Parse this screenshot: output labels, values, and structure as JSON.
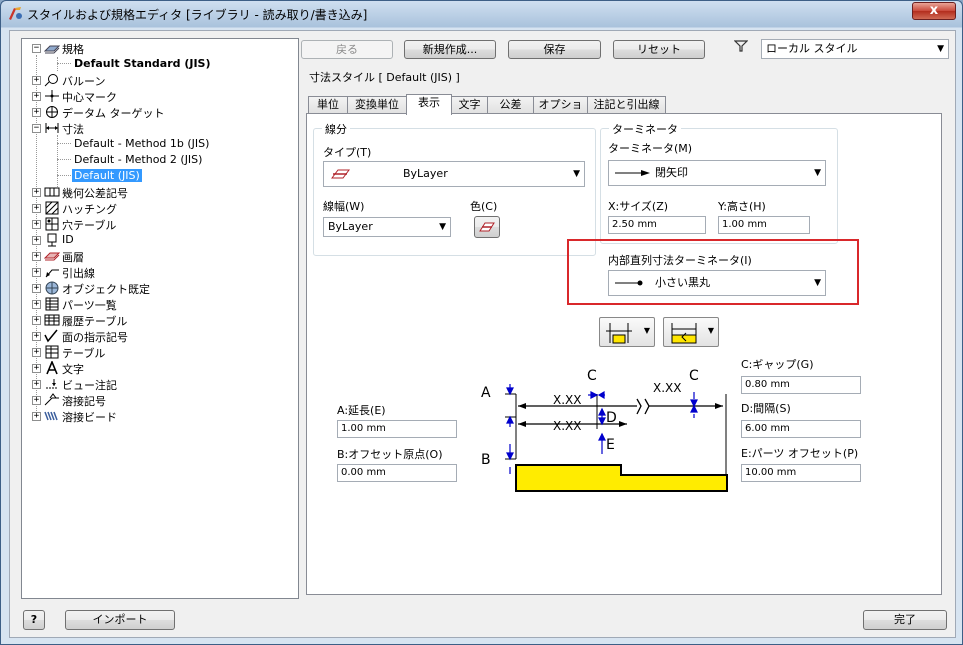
{
  "window": {
    "title": "スタイルおよび規格エディタ [ライブラリ - 読み取り/書き込み]",
    "close_label": "x"
  },
  "tree": {
    "root_label": "規格",
    "standard_label": "Default Standard (JIS)",
    "items": [
      {
        "label": "バルーン",
        "icon": "balloon-icon"
      },
      {
        "label": "中心マーク",
        "icon": "center-mark-icon"
      },
      {
        "label": "データム ターゲット",
        "icon": "datum-target-icon"
      },
      {
        "label": "寸法",
        "icon": "dimension-icon"
      },
      {
        "label": "幾何公差記号",
        "icon": "geometric-tolerance-icon"
      },
      {
        "label": "ハッチング",
        "icon": "hatch-icon"
      },
      {
        "label": "穴テーブル",
        "icon": "hole-table-icon"
      },
      {
        "label": "ID",
        "icon": "id-icon"
      },
      {
        "label": "画層",
        "icon": "layer-icon"
      },
      {
        "label": "引出線",
        "icon": "leader-icon"
      },
      {
        "label": "オブジェクト既定",
        "icon": "object-defaults-icon"
      },
      {
        "label": "パーツ一覧",
        "icon": "parts-list-icon"
      },
      {
        "label": "履歴テーブル",
        "icon": "revision-table-icon"
      },
      {
        "label": "面の指示記号",
        "icon": "surface-texture-icon"
      },
      {
        "label": "テーブル",
        "icon": "table-icon"
      },
      {
        "label": "文字",
        "icon": "text-icon"
      },
      {
        "label": "ビュー注記",
        "icon": "view-annotation-icon"
      },
      {
        "label": "溶接記号",
        "icon": "weld-symbol-icon"
      },
      {
        "label": "溶接ビード",
        "icon": "weld-bead-icon"
      }
    ],
    "dimension_children": [
      "Default - Method 1b (JIS)",
      "Default - Method 2 (JIS)",
      "Default (JIS)"
    ]
  },
  "toolbar": {
    "back_label": "戻る",
    "new_label": "新規作成...",
    "save_label": "保存",
    "reset_label": "リセット",
    "filter_value": "ローカル スタイル"
  },
  "header": {
    "style_title": "寸法スタイル [ Default (JIS) ]"
  },
  "tabs": [
    "単位",
    "変換単位",
    "表示",
    "文字",
    "公差",
    "オプション",
    "注記と引出線"
  ],
  "line_group": {
    "title": "線分",
    "type_label": "タイプ(T)",
    "type_value": "ByLayer",
    "weight_label": "線幅(W)",
    "weight_value": "ByLayer",
    "color_label": "色(C)"
  },
  "terminator_group": {
    "title": "ターミネータ",
    "terminator_label": "ターミネータ(M)",
    "terminator_value": "閉矢印",
    "xsize_label": "X:サイズ(Z)",
    "xsize_value": "2.50 mm",
    "ysize_label": "Y:高さ(H)",
    "ysize_value": "1.00 mm",
    "inner_label": "内部直列寸法ターミネータ(I)",
    "inner_value": "小さい黒丸"
  },
  "params": {
    "a_label": "A:延長(E)",
    "a_value": "1.00 mm",
    "b_label": "B:オフセット原点(O)",
    "b_value": "0.00 mm",
    "c_label": "C:ギャップ(G)",
    "c_value": "0.80 mm",
    "d_label": "D:間隔(S)",
    "d_value": "6.00 mm",
    "e_label": "E:パーツ オフセット(P)",
    "e_value": "10.00 mm"
  },
  "diagram": {
    "label_a": "A",
    "label_b": "B",
    "label_c": "C",
    "label_d": "D",
    "label_e": "E",
    "xx": "X.XX"
  },
  "footer": {
    "help_label": "?",
    "import_label": "インポート",
    "done_label": "完了"
  }
}
